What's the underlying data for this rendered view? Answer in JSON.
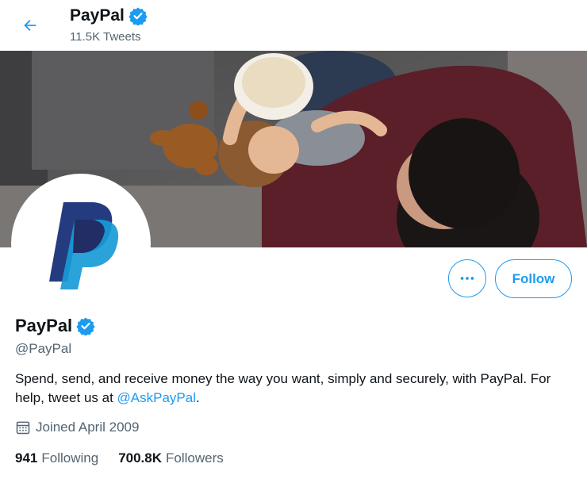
{
  "colors": {
    "accent": "#1d9bf0",
    "text_primary": "#0f1419",
    "text_secondary": "#536471",
    "paypal_dark": "#253b80",
    "paypal_light": "#179bd7"
  },
  "header": {
    "back_icon": "arrow-left-icon",
    "name": "PayPal",
    "verified_icon": "verified-badge-icon",
    "tweet_count": "11.5K Tweets"
  },
  "banner": {
    "description_icon": "banner-photo"
  },
  "actions": {
    "more_icon": "more-horizontal-icon",
    "follow_label": "Follow"
  },
  "profile": {
    "name": "PayPal",
    "handle": "@PayPal",
    "bio_text": "Spend, send, and receive money the way you want, simply and securely, with PayPal. For help, tweet us at ",
    "bio_mention": "@AskPayPal",
    "bio_end": ".",
    "joined_icon": "calendar-icon",
    "joined": "Joined April 2009"
  },
  "stats": {
    "following_count": "941",
    "following_label": "Following",
    "followers_count": "700.8K",
    "followers_label": "Followers"
  }
}
